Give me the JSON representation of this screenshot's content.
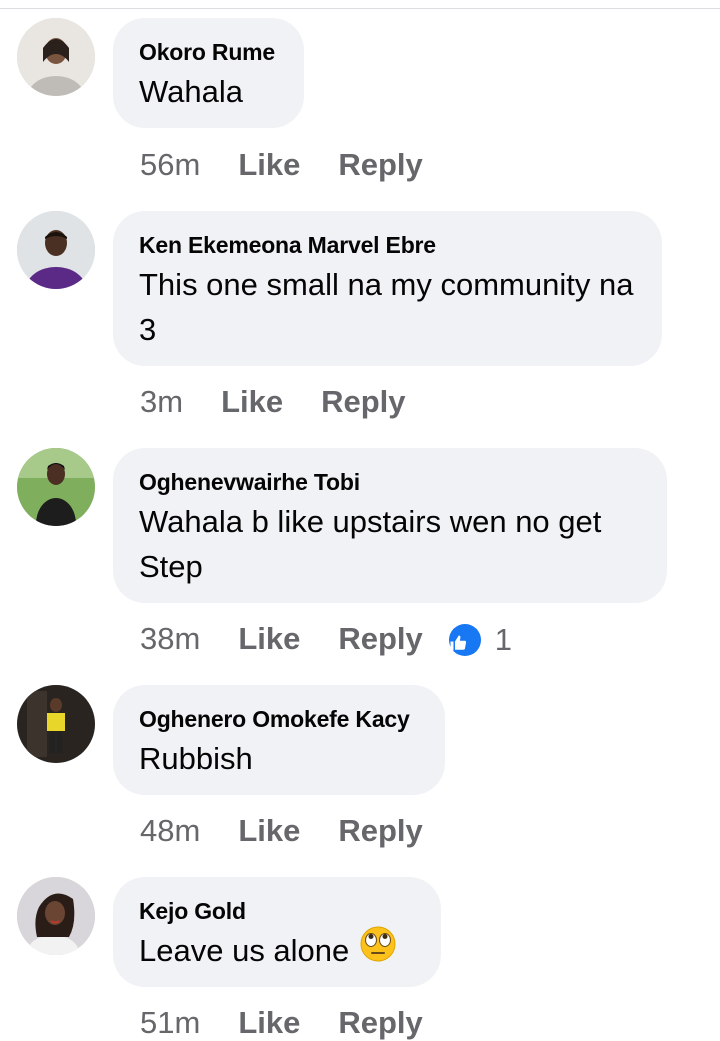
{
  "comments": [
    {
      "author": "Okoro Rume",
      "text": "Wahala",
      "time": "56m",
      "like_label": "Like",
      "reply_label": "Reply"
    },
    {
      "author": "Ken Ekemeona Marvel Ebre",
      "text": "This one small na my community na 3",
      "time": "3m",
      "like_label": "Like",
      "reply_label": "Reply"
    },
    {
      "author": "Oghenevwairhe Tobi",
      "text": "Wahala b like upstairs wen no get Step",
      "time": "38m",
      "like_label": "Like",
      "reply_label": "Reply",
      "reaction_count": "1"
    },
    {
      "author": "Oghenero Omokefe Kacy",
      "text": "Rubbish",
      "time": "48m",
      "like_label": "Like",
      "reply_label": "Reply"
    },
    {
      "author": "Kejo Gold",
      "text": "Leave us alone",
      "emoji": "face-with-rolling-eyes",
      "time": "51m",
      "like_label": "Like",
      "reply_label": "Reply"
    }
  ],
  "colors": {
    "bubble": "#f0f2f5",
    "meta_text": "#65676b",
    "like_badge": "#1877f2"
  },
  "icons": [
    "thumbs-up-icon",
    "rolling-eyes-emoji"
  ]
}
